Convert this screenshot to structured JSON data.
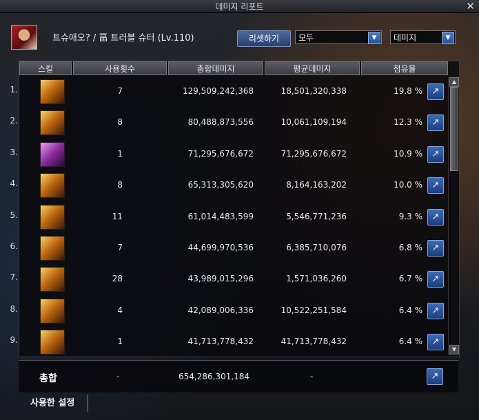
{
  "window": {
    "title": "데미지 리포트"
  },
  "header": {
    "character": "트슈애오? / 畐 트러블 슈터 (Lv.110)",
    "reset_label": "리셋하기",
    "filter_selected": "모두",
    "metric_selected": "데미지"
  },
  "table": {
    "columns": [
      "스킬",
      "사용횟수",
      "총합데미지",
      "평균데미지",
      "점유율"
    ],
    "rows": [
      {
        "index": "1.",
        "count": "7",
        "total": "129,509,242,368",
        "avg": "18,501,320,338",
        "share": "19.8 %"
      },
      {
        "index": "2.",
        "count": "8",
        "total": "80,488,873,556",
        "avg": "10,061,109,194",
        "share": "12.3 %"
      },
      {
        "index": "3.",
        "count": "1",
        "total": "71,295,676,672",
        "avg": "71,295,676,672",
        "share": "10.9 %"
      },
      {
        "index": "4.",
        "count": "8",
        "total": "65,313,305,620",
        "avg": "8,164,163,202",
        "share": "10.0 %"
      },
      {
        "index": "5.",
        "count": "11",
        "total": "61,014,483,599",
        "avg": "5,546,771,236",
        "share": "9.3 %"
      },
      {
        "index": "6.",
        "count": "7",
        "total": "44,699,970,536",
        "avg": "6,385,710,076",
        "share": "6.8 %"
      },
      {
        "index": "7.",
        "count": "28",
        "total": "43,989,015,296",
        "avg": "1,571,036,260",
        "share": "6.7 %"
      },
      {
        "index": "8.",
        "count": "4",
        "total": "42,089,006,336",
        "avg": "10,522,251,584",
        "share": "6.4 %"
      },
      {
        "index": "9.",
        "count": "1",
        "total": "41,713,778,432",
        "avg": "41,713,778,432",
        "share": "6.4 %"
      }
    ]
  },
  "summary": {
    "label": "총합",
    "count": "-",
    "total": "654,286,301,184",
    "avg": "-"
  },
  "footer": {
    "settings_tab": "사용한 설정"
  },
  "colors": {
    "accent": "#2a4f9a",
    "header_bg": "#4a4b52"
  },
  "icons": {
    "share": "share-export-icon",
    "close": "close-icon"
  }
}
